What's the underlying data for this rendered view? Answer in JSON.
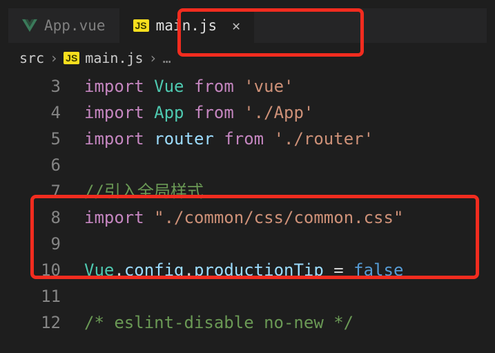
{
  "tabs": [
    {
      "icon": "vue-icon",
      "label": "App.vue",
      "active": false
    },
    {
      "icon": "js-icon",
      "label": "main.js",
      "active": true
    }
  ],
  "breadcrumbs": {
    "parts": [
      "src",
      "main.js"
    ],
    "ellipsis": "…"
  },
  "code": {
    "lines": [
      {
        "num": "3",
        "tokens": [
          [
            "kw",
            "import"
          ],
          [
            "punct",
            " "
          ],
          [
            "cls",
            "Vue"
          ],
          [
            "punct",
            " "
          ],
          [
            "kw",
            "from"
          ],
          [
            "punct",
            " "
          ],
          [
            "str",
            "'vue'"
          ]
        ]
      },
      {
        "num": "4",
        "tokens": [
          [
            "kw",
            "import"
          ],
          [
            "punct",
            " "
          ],
          [
            "cls",
            "App"
          ],
          [
            "punct",
            " "
          ],
          [
            "kw",
            "from"
          ],
          [
            "punct",
            " "
          ],
          [
            "str",
            "'./App'"
          ]
        ]
      },
      {
        "num": "5",
        "tokens": [
          [
            "kw",
            "import"
          ],
          [
            "punct",
            " "
          ],
          [
            "prop",
            "router"
          ],
          [
            "punct",
            " "
          ],
          [
            "kw",
            "from"
          ],
          [
            "punct",
            " "
          ],
          [
            "str",
            "'./router'"
          ]
        ]
      },
      {
        "num": "6",
        "tokens": []
      },
      {
        "num": "7",
        "tokens": [
          [
            "comment",
            "//引入全局样式"
          ]
        ]
      },
      {
        "num": "8",
        "tokens": [
          [
            "kw",
            "import"
          ],
          [
            "punct",
            " "
          ],
          [
            "str",
            "\"./common/css/common.css\""
          ]
        ]
      },
      {
        "num": "9",
        "tokens": []
      },
      {
        "num": "10",
        "tokens": [
          [
            "cls",
            "Vue"
          ],
          [
            "punct",
            "."
          ],
          [
            "prop",
            "config"
          ],
          [
            "punct",
            "."
          ],
          [
            "prop",
            "productionTip"
          ],
          [
            "punct",
            " = "
          ],
          [
            "const",
            "false"
          ]
        ]
      },
      {
        "num": "11",
        "tokens": []
      },
      {
        "num": "12",
        "tokens": [
          [
            "comment",
            "/* eslint-disable no-new */"
          ]
        ]
      }
    ]
  },
  "icons": {
    "js": "JS"
  }
}
